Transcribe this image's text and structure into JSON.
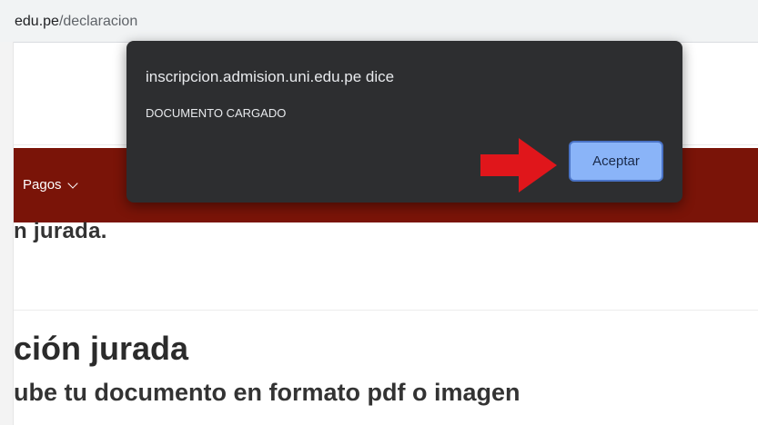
{
  "browser": {
    "url_domain": "edu.pe",
    "url_path": "/declaracion"
  },
  "page": {
    "nav_item": "Pagos",
    "crumb": "n jurada.",
    "heading": "ción jurada",
    "subheading": "ube tu documento en formato pdf o imagen"
  },
  "dialog": {
    "origin": "inscripcion.admision.uni.edu.pe dice",
    "message": "DOCUMENTO CARGADO",
    "accept_label": "Aceptar"
  },
  "colors": {
    "navbar": "#7a1408",
    "dialog_bg": "#2d2e30",
    "accept_button": "#8ab4f8",
    "annotation_arrow": "#e0161b"
  }
}
